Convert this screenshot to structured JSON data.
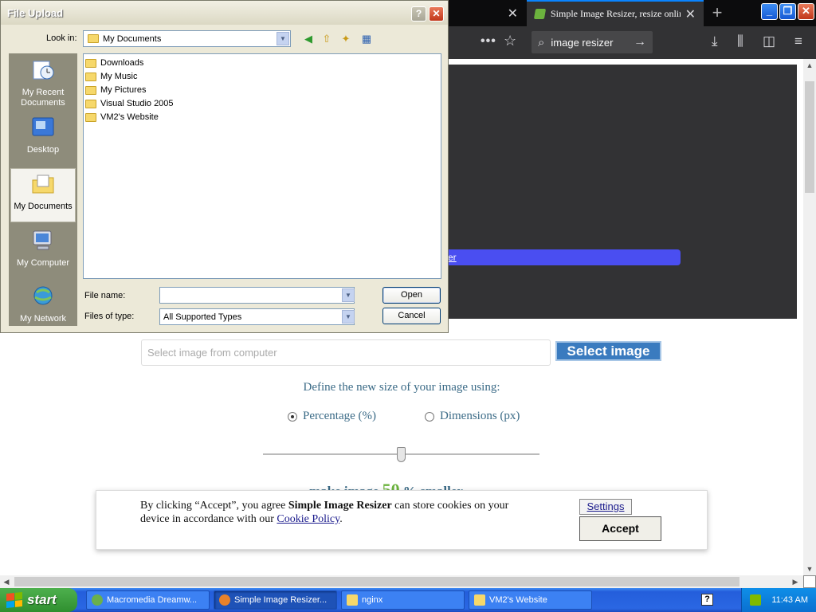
{
  "browser": {
    "tabs": [
      {
        "title": "",
        "close": "✕"
      },
      {
        "title": "Simple Image Resizer, resize online",
        "close": "✕"
      }
    ],
    "new_tab": "+",
    "search_value": "image resizer"
  },
  "page": {
    "blue_bar_text": "er",
    "file_placeholder": "Select image from computer",
    "select_image_label": "Select image",
    "define_text": "Define the new size of your image using:",
    "radio_percentage": "Percentage (%)",
    "radio_dimensions": "Dimensions (px)",
    "slider_value_percent": 50,
    "make_prefix": "make image",
    "make_value": "50",
    "make_suffix": "% smaller",
    "cookie": {
      "text_a": "By clicking “Accept”, you agree ",
      "brand": "Simple Image Resizer",
      "text_b": " can store cookies on your device in accordance with our ",
      "policy_link": "Cookie Policy",
      "text_c": ".",
      "settings": "Settings",
      "accept": "Accept"
    }
  },
  "dialog": {
    "title": "File Upload",
    "help": "?",
    "close": "✕",
    "look_in_label": "Look in:",
    "look_in_value": "My Documents",
    "places": [
      "My Recent Documents",
      "Desktop",
      "My Documents",
      "My Computer",
      "My Network"
    ],
    "files": [
      "Downloads",
      "My Music",
      "My Pictures",
      "Visual Studio 2005",
      "VM2's Website"
    ],
    "file_name_label": "File name:",
    "file_name_value": "",
    "files_of_type_label": "Files of type:",
    "files_of_type_value": "All Supported Types",
    "open": "Open",
    "cancel": "Cancel"
  },
  "taskbar": {
    "start": "start",
    "items": [
      "Macromedia Dreamw...",
      "Simple Image Resizer...",
      "nginx",
      "VM2's Website"
    ],
    "clock": "11:43 AM"
  },
  "colors": {
    "firefox_dark": "#0c0c0d",
    "firefox_toolbar": "#323234",
    "select_button": "#3a7bbf",
    "accent_green": "#6cb33e",
    "xp_blue": "#245edb"
  }
}
